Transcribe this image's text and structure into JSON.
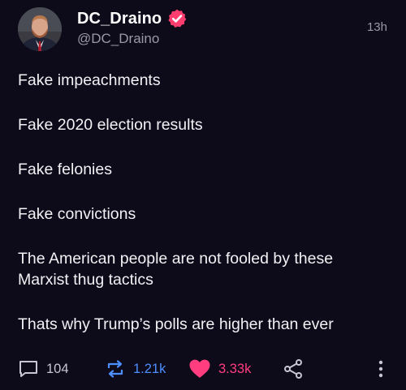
{
  "author": {
    "display_name": "DC_Draino",
    "handle": "@DC_Draino",
    "verified": true,
    "verified_color": "#ff3d6e"
  },
  "post": {
    "timestamp": "13h",
    "paragraphs": [
      "Fake impeachments",
      "Fake 2020 election results",
      "Fake felonies",
      "Fake convictions",
      "The American people are not fooled by these Marxist thug tactics",
      "Thats why Trump’s polls are higher than ever"
    ]
  },
  "stats": {
    "replies": "104",
    "reposts": "1.21k",
    "likes": "3.33k"
  },
  "icons": {
    "reply": "comment-icon",
    "repost": "repost-icon",
    "like": "heart-icon",
    "share": "share-icon",
    "more": "more-vertical-icon"
  },
  "colors": {
    "background": "#0d0a1a",
    "repost_accent": "#4d8fff",
    "like_accent": "#ff3d7f",
    "muted_text": "#9a98a8"
  }
}
